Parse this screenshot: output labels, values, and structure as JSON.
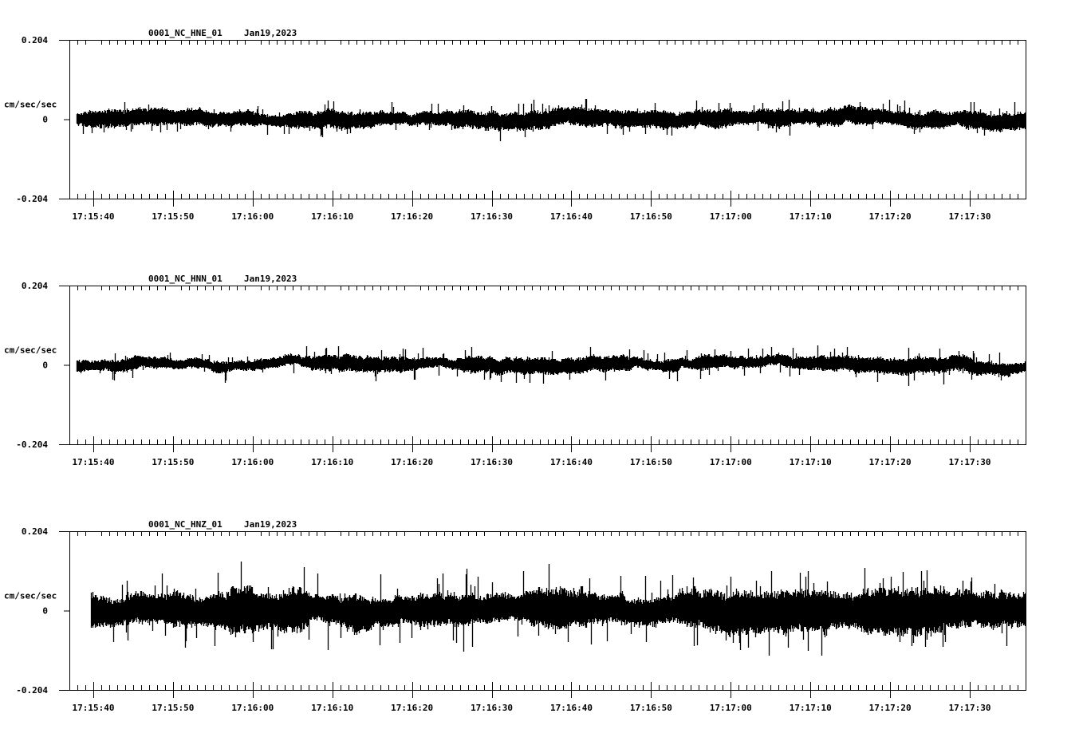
{
  "chart_data": [
    {
      "type": "line",
      "title": "0001_NC_HNE_01",
      "date": "Jan19,2023",
      "ylabel": "cm/sec/sec",
      "ylim": [
        -0.204,
        0.204
      ],
      "ytick_labels": [
        "0.204",
        "0",
        "-0.204"
      ],
      "xlim_seconds": [
        -3,
        117
      ],
      "x_tick_labels": [
        "17:15:40",
        "17:15:50",
        "17:16:00",
        "17:16:10",
        "17:16:20",
        "17:16:30",
        "17:16:40",
        "17:16:50",
        "17:17:00",
        "17:17:10",
        "17:17:20",
        "17:17:30"
      ],
      "signal_start_seconds": -2.1,
      "noise_amplitude": 0.018,
      "peak_amplitude": 0.045,
      "seed": 11
    },
    {
      "type": "line",
      "title": "0001_NC_HNN_01",
      "date": "Jan19,2023",
      "ylabel": "cm/sec/sec",
      "ylim": [
        -0.204,
        0.204
      ],
      "ytick_labels": [
        "0.204",
        "0",
        "-0.204"
      ],
      "xlim_seconds": [
        -3,
        117
      ],
      "x_tick_labels": [
        "17:15:40",
        "17:15:50",
        "17:16:00",
        "17:16:10",
        "17:16:20",
        "17:16:30",
        "17:16:40",
        "17:16:50",
        "17:17:00",
        "17:17:10",
        "17:17:20",
        "17:17:30"
      ],
      "signal_start_seconds": -2.1,
      "noise_amplitude": 0.016,
      "peak_amplitude": 0.045,
      "seed": 23
    },
    {
      "type": "line",
      "title": "0001_NC_HNZ_01",
      "date": "Jan19,2023",
      "ylabel": "cm/sec/sec",
      "ylim": [
        -0.204,
        0.204
      ],
      "ytick_labels": [
        "0.204",
        "0",
        "-0.204"
      ],
      "xlim_seconds": [
        -3,
        117
      ],
      "x_tick_labels": [
        "17:15:40",
        "17:15:50",
        "17:16:00",
        "17:16:10",
        "17:16:20",
        "17:16:30",
        "17:16:40",
        "17:16:50",
        "17:17:00",
        "17:17:10",
        "17:17:20",
        "17:17:30"
      ],
      "signal_start_seconds": -0.3,
      "noise_amplitude": 0.045,
      "peak_amplitude": 0.11,
      "seed": 37
    }
  ]
}
